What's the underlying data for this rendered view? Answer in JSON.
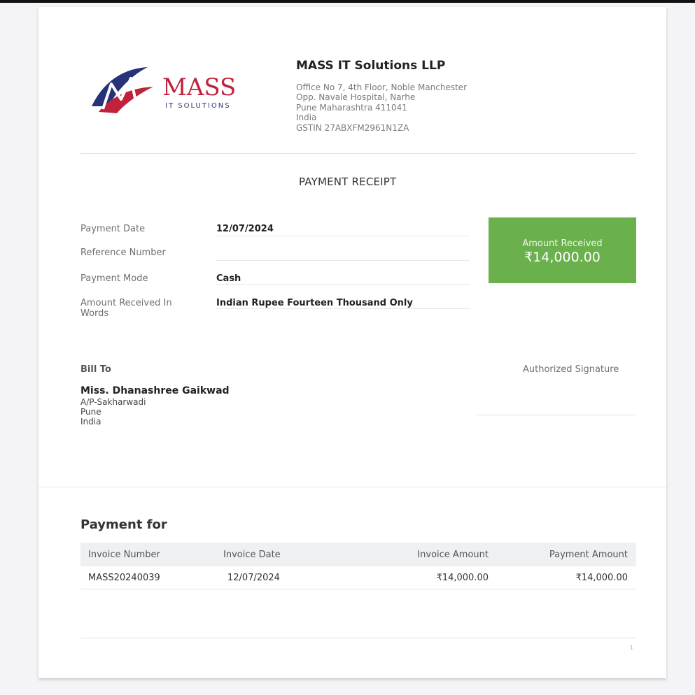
{
  "company": {
    "logo_text": "MASS",
    "logo_subtext": "IT SOLUTIONS",
    "name": "MASS IT Solutions LLP",
    "address_lines": [
      "Office No 7, 4th Floor, Noble Manchester",
      "Opp. Navale Hospital, Narhe",
      "Pune Maharashtra 411041",
      "India",
      "GSTIN 27ABXFM2961N1ZA"
    ]
  },
  "receipt": {
    "title": "PAYMENT RECEIPT",
    "fields": {
      "payment_date_label": "Payment Date",
      "payment_date": "12/07/2024",
      "reference_number_label": "Reference Number",
      "reference_number": "",
      "payment_mode_label": "Payment Mode",
      "payment_mode": "Cash",
      "amount_words_label_1": "Amount Received In",
      "amount_words_label_2": "Words",
      "amount_words": "Indian Rupee Fourteen Thousand Only"
    },
    "amount_box": {
      "label": "Amount Received",
      "value": "₹14,000.00"
    }
  },
  "bill_to": {
    "label": "Bill To",
    "name": "Miss. Dhanashree Gaikwad",
    "lines": [
      "A/P-Sakharwadi",
      "Pune",
      "India"
    ]
  },
  "signature": {
    "label": "Authorized Signature"
  },
  "payment_for": {
    "title": "Payment for",
    "columns": [
      "Invoice Number",
      "Invoice Date",
      "Invoice Amount",
      "Payment Amount"
    ],
    "rows": [
      [
        "MASS20240039",
        "12/07/2024",
        "₹14,000.00",
        "₹14,000.00"
      ]
    ]
  },
  "footer": {
    "page_number": "1"
  },
  "colors": {
    "accent_green": "#6ab04c",
    "logo_red": "#c0223b",
    "logo_navy": "#26337a"
  }
}
